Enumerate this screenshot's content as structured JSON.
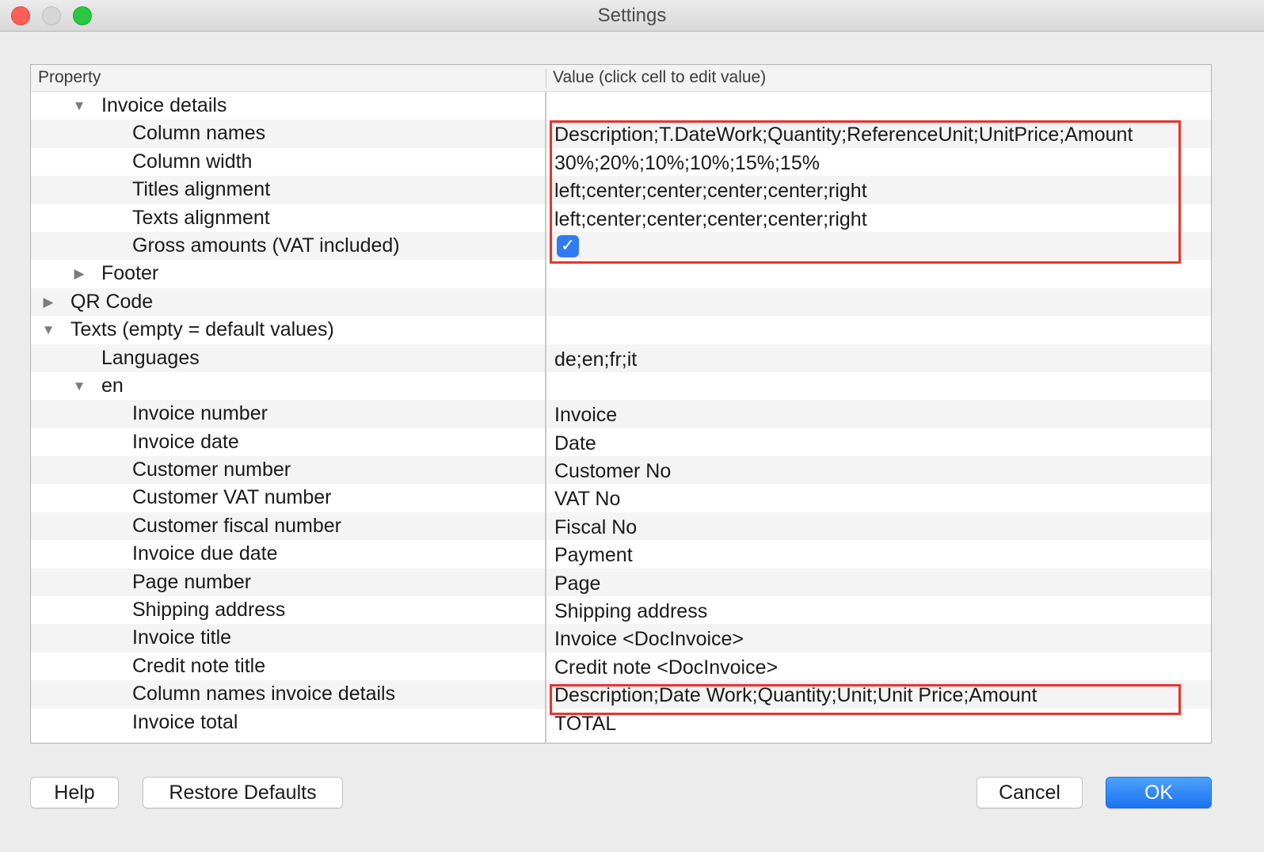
{
  "window": {
    "title": "Settings"
  },
  "table": {
    "headers": {
      "property": "Property",
      "value": "Value (click cell to edit value)"
    },
    "rows": [
      {
        "label": "Invoice details",
        "value": "",
        "disclosure": "▼"
      },
      {
        "label": "Column names",
        "value": "Description;T.DateWork;Quantity;ReferenceUnit;UnitPrice;Amount"
      },
      {
        "label": "Column width",
        "value": "30%;20%;10%;10%;15%;15%"
      },
      {
        "label": "Titles alignment",
        "value": "left;center;center;center;center;right"
      },
      {
        "label": "Texts alignment",
        "value": "left;center;center;center;center;right"
      },
      {
        "label": "Gross amounts (VAT included)",
        "value": "",
        "checked": true
      },
      {
        "label": "Footer",
        "value": "",
        "disclosure": "▶"
      },
      {
        "label": "QR Code",
        "value": "",
        "disclosure": "▶"
      },
      {
        "label": "Texts (empty = default values)",
        "value": "",
        "disclosure": "▼"
      },
      {
        "label": "Languages",
        "value": "de;en;fr;it"
      },
      {
        "label": "en",
        "value": "",
        "disclosure": "▼"
      },
      {
        "label": "Invoice number",
        "value": "Invoice"
      },
      {
        "label": "Invoice date",
        "value": "Date"
      },
      {
        "label": "Customer number",
        "value": "Customer No"
      },
      {
        "label": "Customer VAT number",
        "value": "VAT No"
      },
      {
        "label": "Customer fiscal number",
        "value": "Fiscal No"
      },
      {
        "label": "Invoice due date",
        "value": "Payment"
      },
      {
        "label": "Page number",
        "value": "Page"
      },
      {
        "label": "Shipping address",
        "value": "Shipping address"
      },
      {
        "label": "Invoice title",
        "value": "Invoice <DocInvoice>"
      },
      {
        "label": "Credit note title",
        "value": "Credit note <DocInvoice>"
      },
      {
        "label": "Column names invoice details",
        "value": "Description;Date Work;Quantity;Unit;Unit Price;Amount"
      },
      {
        "label": "Invoice total",
        "value": "TOTAL"
      }
    ]
  },
  "checkbox_glyph": "✓",
  "buttons": {
    "help": "Help",
    "restore_defaults": "Restore Defaults",
    "cancel": "Cancel",
    "ok": "OK"
  },
  "colors": {
    "accent": "#1a73f3",
    "highlight_border": "#e8352b"
  }
}
